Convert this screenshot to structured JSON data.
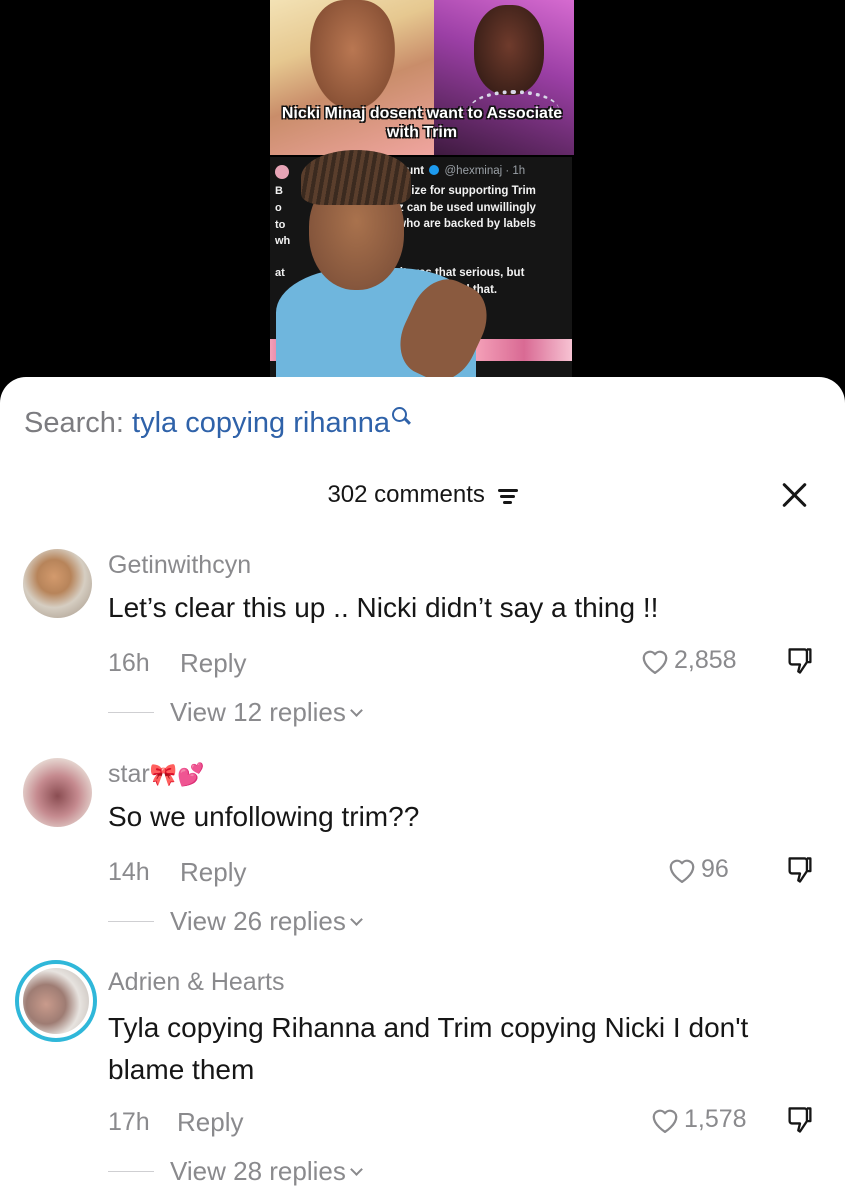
{
  "video": {
    "caption": "Nicki Minaj dosent want to Associate with Trim",
    "tweet": {
      "account_fragment": "account",
      "handle": "@hexminaj · 1h",
      "lines": [
        "pologize for supporting Trim",
        "arbz can be used unwillingly",
        "rls who are backed by labels",
        "ink it was that serious, but",
        "missed that."
      ],
      "left_fragments": [
        "B",
        "o",
        "to",
        "wh",
        "at"
      ]
    }
  },
  "search": {
    "label": "Search:",
    "term": "tyla copying rihanna",
    "icon": "search-icon"
  },
  "header": {
    "comment_count": "302 comments",
    "sort_icon": "sort-icon",
    "close_icon": "close-icon"
  },
  "comments": [
    {
      "username": "Getinwithcyn",
      "text": "Let’s clear this up .. Nicki didn’t say a thing !!",
      "time": "16h",
      "reply_label": "Reply",
      "likes": "2,858",
      "view_replies": "View 12 replies"
    },
    {
      "username": "star",
      "username_emoji": "🎀💕",
      "text": "So we unfollowing trim??",
      "time": "14h",
      "reply_label": "Reply",
      "likes": "96",
      "view_replies": "View 26 replies"
    },
    {
      "username": "Adrien & Hearts",
      "text": "Tyla copying Rihanna and Trim copying Nicki I don't blame them",
      "time": "17h",
      "reply_label": "Reply",
      "likes": "1,578",
      "view_replies": "View 28 replies"
    }
  ],
  "colors": {
    "accent_blue": "#2f62a9",
    "muted_gray": "#8a8a8d",
    "text_dark": "#161616",
    "story_ring": "#2fb7d9"
  }
}
